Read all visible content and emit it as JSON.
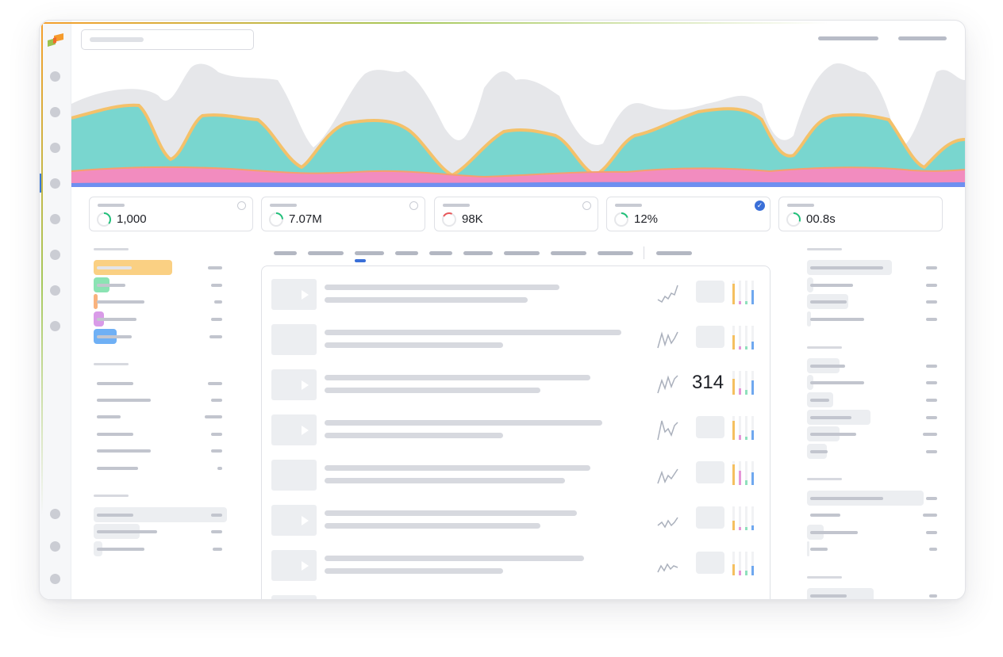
{
  "kpis": [
    {
      "value": "1,000",
      "ring_color": "#21c07a",
      "ring_fraction": 0.35,
      "control": "radio"
    },
    {
      "value": "7.07M",
      "ring_color": "#21c07a",
      "ring_fraction": 0.25,
      "control": "radio"
    },
    {
      "value": "98K",
      "ring_color": "#e8575a",
      "ring_fraction": 0.25,
      "control": "radio"
    },
    {
      "value": "12%",
      "ring_color": "#21c07a",
      "ring_fraction": 0.2,
      "control": "check"
    },
    {
      "value": "00.8s",
      "ring_color": "#21c07a",
      "ring_fraction": 0.3,
      "control": "none"
    }
  ],
  "list": {
    "highlight_value": "314",
    "highlight_row": 2
  },
  "colors": {
    "teal": "#79d6cf",
    "orange": "#f4c16a",
    "pink": "#f28cbf",
    "blue": "#6f8ff0",
    "gray_area": "#e6e7ea",
    "accent": "#3a6fd8",
    "legend": [
      "#fad083",
      "#8be3b3",
      "#f9b27d",
      "#d99be8",
      "#6fb0f5"
    ],
    "mini_bars": [
      "#f5c05f",
      "#e696d8",
      "#8fe0bc",
      "#6fa8ef"
    ]
  },
  "icons": {
    "logo": "brand-logo-icon",
    "play": "play-icon",
    "check": "check-icon"
  }
}
